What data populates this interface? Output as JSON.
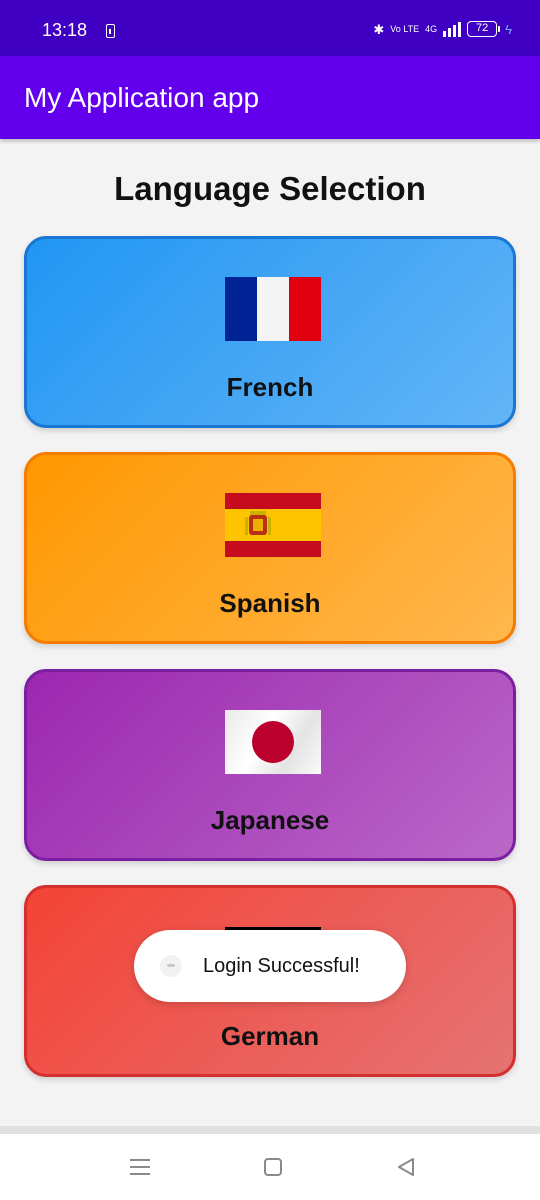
{
  "status_bar": {
    "time": "13:18",
    "network": "4G",
    "volte": "Vo LTE",
    "battery": "72"
  },
  "app_bar": {
    "title": "My Application app"
  },
  "heading": "Language Selection",
  "languages": [
    {
      "label": "French",
      "flag": "france-flag",
      "color": "#2196f3"
    },
    {
      "label": "Spanish",
      "flag": "spain-flag",
      "color": "#ff9800"
    },
    {
      "label": "Japanese",
      "flag": "japan-flag",
      "color": "#9c27b0"
    },
    {
      "label": "German",
      "flag": "germany-flag",
      "color": "#f44336"
    }
  ],
  "toast": {
    "message": "Login Successful!"
  },
  "nav_bar": {
    "icons": [
      "menu-icon",
      "home-icon",
      "back-icon"
    ]
  }
}
